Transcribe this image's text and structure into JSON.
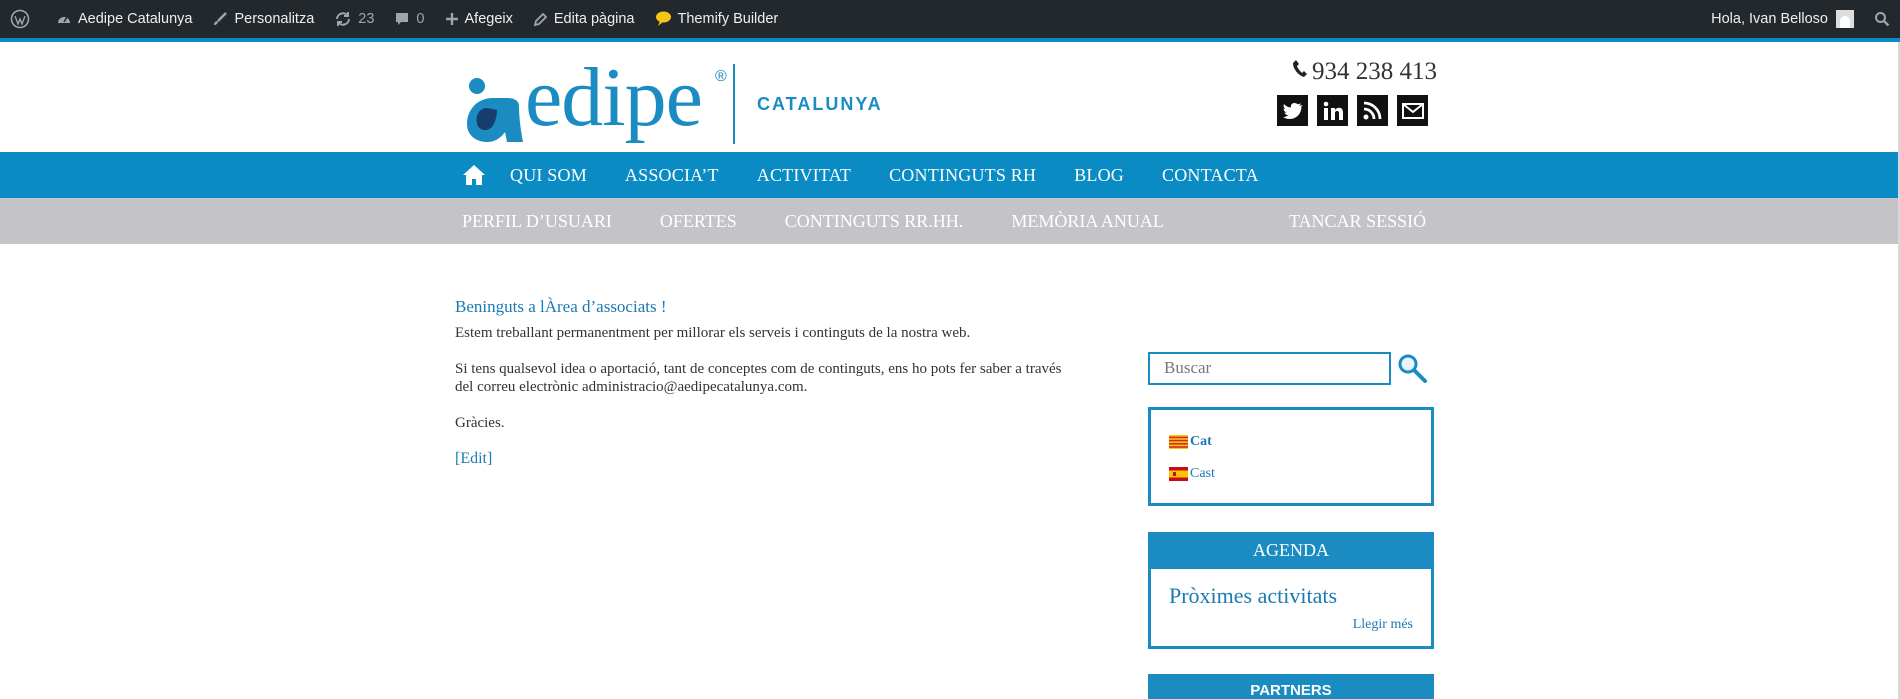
{
  "adminbar": {
    "site_name": "Aedipe Catalunya",
    "customize": "Personalitza",
    "updates_count": "23",
    "comments_count": "0",
    "add_new": "Afegeix",
    "edit_page": "Edita pàgina",
    "builder": "Themify Builder",
    "greeting": "Hola, Ivan Belloso"
  },
  "header": {
    "brand": "edipe",
    "reg": "®",
    "region": "CATALUNYA",
    "phone": "934 238 413"
  },
  "mainnav": {
    "items": [
      "QUI SOM",
      "ASSOCIA’T",
      "ACTIVITAT",
      "CONTINGUTS RH",
      "BLOG",
      "CONTACTA"
    ]
  },
  "subnav": {
    "items": [
      "PERFIL D’USUARI",
      "OFERTES",
      "CONTINGUTS RR.HH.",
      "MEMÒRIA ANUAL"
    ],
    "logout": "TANCAR SESSIÓ"
  },
  "content": {
    "title": "Beninguts a lÀrea d’associats !",
    "p1": "Estem treballant permanentment per millorar els serveis i continguts de la nostra web.",
    "p2": "Si tens qualsevol idea o aportació, tant de conceptes com de continguts, ens ho pots fer saber a través del correu electrònic administracio@aedipecatalunya.com.",
    "p3": "Gràcies.",
    "edit": "[Edit]"
  },
  "sidebar": {
    "search_placeholder": "Buscar",
    "lang_cat": "Cat",
    "lang_cast": "Cast",
    "agenda_head": "AGENDA",
    "agenda_title": "Pròximes activitats",
    "agenda_more": "Llegir més",
    "partners_head": "PARTNERS"
  },
  "colors": {
    "accent": "#0b8bc4",
    "subnav": "#c3c3c8",
    "adminbar": "#23282d"
  }
}
